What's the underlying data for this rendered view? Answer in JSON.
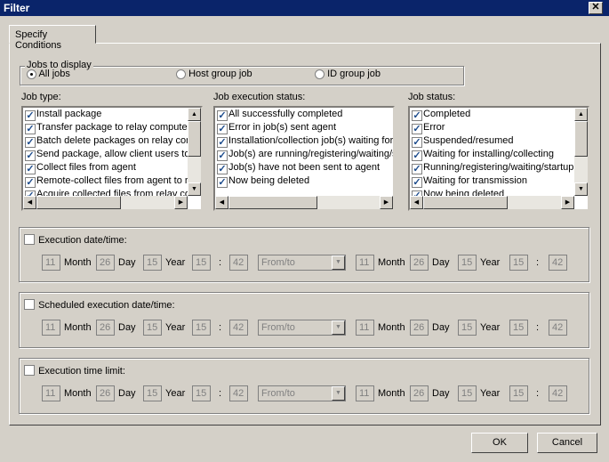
{
  "window": {
    "title": "Filter",
    "close_icon": "close-icon"
  },
  "tabs": [
    {
      "label": "Specify Conditions",
      "active": true
    }
  ],
  "jobs_to_display": {
    "legend": "Jobs to display",
    "options": [
      {
        "label": "All jobs",
        "selected": true
      },
      {
        "label": "Host group job",
        "selected": false
      },
      {
        "label": "ID group job",
        "selected": false
      }
    ]
  },
  "lists": [
    {
      "label": "Job type:",
      "items": [
        "Install package",
        "Transfer package to relay computer",
        "Batch delete packages on relay compu",
        "Send package, allow client users to ch",
        "Collect files from agent",
        "Remote-collect files from agent to relay",
        "Acquire collected files from relay comp"
      ],
      "checked": true,
      "vscroll": true
    },
    {
      "label": "Job execution status:",
      "items": [
        "All successfully completed",
        "Error in job(s) sent agent",
        "Installation/collection job(s) waiting for age",
        "Job(s) are running/registering/waiting/star",
        "Job(s) have not been sent to agent",
        "Now being deleted"
      ],
      "checked": true,
      "vscroll": false
    },
    {
      "label": "Job status:",
      "items": [
        "Completed",
        "Error",
        "Suspended/resumed",
        "Waiting for installing/collecting",
        "Running/registering/waiting/startup fail",
        "Waiting for transmission",
        "Now being deleted"
      ],
      "checked": true,
      "vscroll": true
    }
  ],
  "date_groups": [
    {
      "label": "Execution date/time:",
      "checked": false,
      "from": {
        "month": "11",
        "day": "26",
        "year": "15",
        "hour": "15",
        "minute": "42"
      },
      "range": "From/to",
      "to": {
        "month": "11",
        "day": "26",
        "year": "15",
        "hour": "15",
        "minute": "42"
      }
    },
    {
      "label": "Scheduled execution date/time:",
      "checked": false,
      "from": {
        "month": "11",
        "day": "26",
        "year": "15",
        "hour": "15",
        "minute": "42"
      },
      "range": "From/to",
      "to": {
        "month": "11",
        "day": "26",
        "year": "15",
        "hour": "15",
        "minute": "42"
      }
    },
    {
      "label": "Execution time limit:",
      "checked": false,
      "from": {
        "month": "11",
        "day": "26",
        "year": "15",
        "hour": "15",
        "minute": "42"
      },
      "range": "From/to",
      "to": {
        "month": "11",
        "day": "26",
        "year": "15",
        "hour": "15",
        "minute": "42"
      }
    }
  ],
  "units": {
    "month": "Month",
    "day": "Day",
    "year": "Year",
    "colon": ":"
  },
  "buttons": {
    "ok": "OK",
    "cancel": "Cancel"
  }
}
